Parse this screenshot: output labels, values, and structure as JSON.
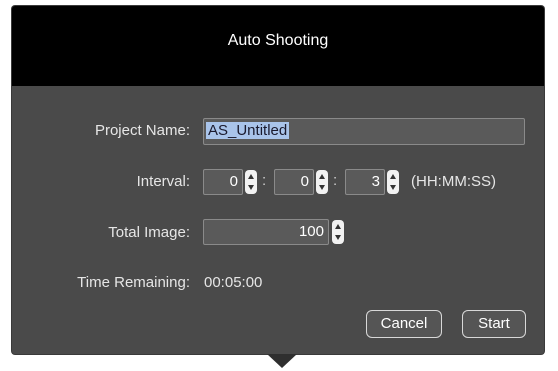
{
  "dialog": {
    "title": "Auto Shooting"
  },
  "form": {
    "project_name_label": "Project Name:",
    "project_name_value": "AS_Untitled",
    "interval_label": "Interval:",
    "interval_hours": "0",
    "interval_minutes": "0",
    "interval_seconds": "3",
    "interval_separator": ":",
    "interval_format": "(HH:MM:SS)",
    "total_image_label": "Total Image:",
    "total_image_value": "100",
    "time_remaining_label": "Time Remaining:",
    "time_remaining_value": "00:05:00"
  },
  "buttons": {
    "cancel_label": "Cancel",
    "start_label": "Start"
  },
  "icons": {
    "stepper": "up-down-arrows-icon"
  }
}
